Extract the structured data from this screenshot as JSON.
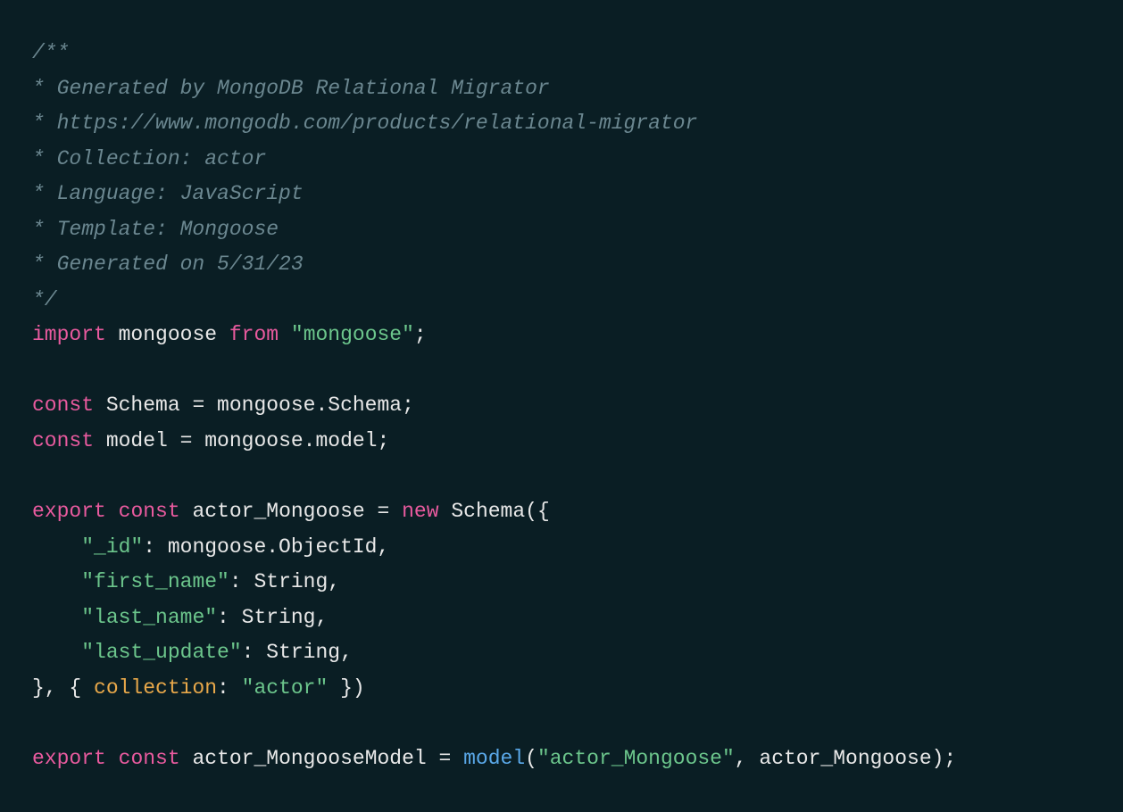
{
  "code": {
    "comment_open": "/**",
    "comment_l1": "* Generated by MongoDB Relational Migrator",
    "comment_l2": "* https://www.mongodb.com/products/relational-migrator",
    "comment_l3": "* Collection: actor",
    "comment_l4": "* Language: JavaScript",
    "comment_l5": "* Template: Mongoose",
    "comment_l6": "* Generated on 5/31/23",
    "comment_close": "*/",
    "kw_import": "import",
    "mongoose1": " mongoose ",
    "kw_from": "from",
    "sp1": " ",
    "str_mongoose": "\"mongoose\"",
    "semi1": ";",
    "kw_const1": "const",
    "schema1": " Schema ",
    "eq1": "= ",
    "mongoose_schema": "mongoose.Schema",
    "semi2": ";",
    "kw_const2": "const",
    "model1": " model ",
    "eq2": "= ",
    "mongoose_model": "mongoose.model",
    "semi3": ";",
    "kw_export1": "export",
    "sp2": " ",
    "kw_const3": "const",
    "actor_mongoose": " actor_Mongoose ",
    "eq3": "= ",
    "kw_new": "new",
    "schema_call": " Schema({",
    "indent": "    ",
    "key_id": "\"_id\"",
    "colon_id": ": mongoose.ObjectId,",
    "key_first": "\"first_name\"",
    "colon_first": ": String,",
    "key_last": "\"last_name\"",
    "colon_last": ": String,",
    "key_update": "\"last_update\"",
    "colon_update": ": String,",
    "brace_close": "}, { ",
    "prop_collection": "collection",
    "colon_coll": ": ",
    "str_actor": "\"actor\"",
    "end_opts": " })",
    "kw_export2": "export",
    "sp3": " ",
    "kw_const4": "const",
    "actor_model": " actor_MongooseModel ",
    "eq4": "= ",
    "fn_model": "model",
    "paren_open": "(",
    "str_actor_mongoose": "\"actor_Mongoose\"",
    "comma": ", actor_Mongoose);"
  }
}
